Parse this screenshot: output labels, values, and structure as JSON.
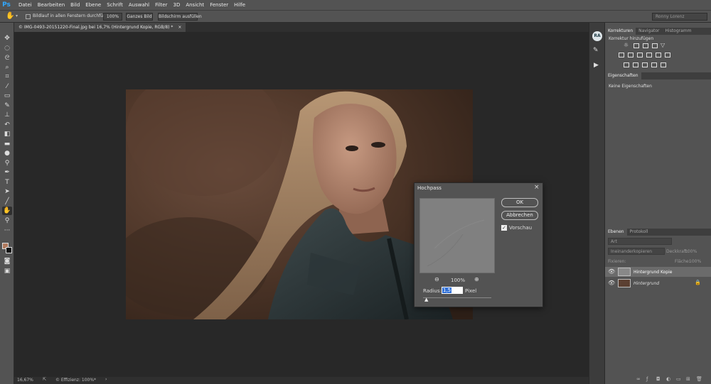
{
  "app": {
    "logo": "Ps"
  },
  "menu": [
    "Datei",
    "Bearbeiten",
    "Bild",
    "Ebene",
    "Schrift",
    "Auswahl",
    "Filter",
    "3D",
    "Ansicht",
    "Fenster",
    "Hilfe"
  ],
  "options": {
    "scroll_all_label": "Bildlauf in allen Fenstern durchführen",
    "zoom_100": "100%",
    "fit_screen": "Ganzes Bild",
    "fill_screen": "Bildschirm ausfüllen",
    "user": "Ronny Lorenz"
  },
  "document": {
    "tab_title": "© IMG-0493-20151220-Final.jpg bei 16,7% (Hintergrund Kopie, RGB/8) *",
    "close": "×"
  },
  "status": {
    "zoom": "16,67%",
    "efficiency": "© Effizienz: 100%*"
  },
  "dock": {
    "ra_badge": "RA"
  },
  "panels": {
    "top_tabs": [
      "Korrekturen",
      "Navigator",
      "Histogramm"
    ],
    "adjustments_title": "Korrektur hinzufügen",
    "properties_tab": "Eigenschaften",
    "properties_empty": "Keine Eigenschaften",
    "layers_tabs": [
      "Ebenen",
      "Protokoll"
    ],
    "filter_type": "Art",
    "blend_mode": "Ineinanderkopieren",
    "opacity_label": "Deckkraft:",
    "opacity_value": "100%",
    "lock_label": "Fixieren:",
    "fill_label": "Fläche:",
    "fill_value": "100%",
    "layers": [
      {
        "name": "Hintergrund Kopie",
        "selected": true
      },
      {
        "name": "Hintergrund",
        "selected": false,
        "locked": true
      }
    ]
  },
  "dialog": {
    "title": "Hochpass",
    "close": "×",
    "ok": "OK",
    "cancel": "Abbrechen",
    "preview_label": "Vorschau",
    "preview_checked": true,
    "zoom": "100%",
    "radius_label": "Radius:",
    "radius_value": "1,5",
    "radius_unit": "Pixel"
  }
}
